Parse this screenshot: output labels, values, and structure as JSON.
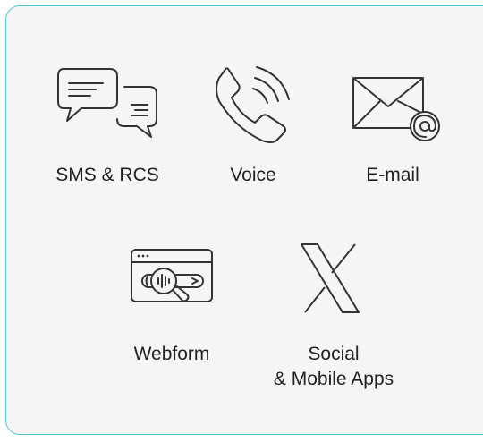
{
  "channels": [
    {
      "label": "SMS & RCS",
      "icon": "chat-bubbles-icon"
    },
    {
      "label": "Voice",
      "icon": "phone-icon"
    },
    {
      "label": "E-mail",
      "icon": "email-icon"
    },
    {
      "label": "Webform",
      "icon": "webform-icon"
    },
    {
      "label_line1": "Social",
      "label_line2": "& Mobile Apps",
      "icon": "x-logo-icon"
    }
  ],
  "colors": {
    "border": "#4fc6e0",
    "background": "#f5f5f5",
    "icon_stroke": "#333333",
    "text": "#222222"
  }
}
